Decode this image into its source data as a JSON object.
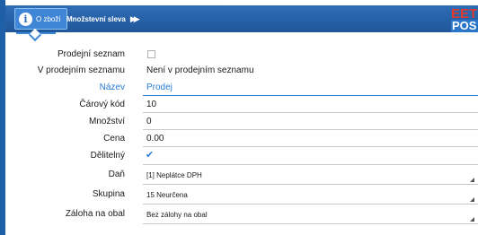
{
  "header": {
    "tab_info_label": "O zboží",
    "tab_discount_label": "Množstevní sleva",
    "logo_top": "EET",
    "logo_bottom": "POS"
  },
  "fields": {
    "sale_list_label": "Prodejní seznam",
    "in_sale_list_label": "V prodejním seznamu",
    "in_sale_list_value": "Není v prodejním seznamu",
    "name_label": "Název",
    "name_value": "Prodej",
    "barcode_label": "Čárový kód",
    "barcode_value": "10",
    "quantity_label": "Množství",
    "quantity_value": "0",
    "price_label": "Cena",
    "price_value": "0.00",
    "divisible_label": "Dělitelný",
    "tax_label": "Daň",
    "tax_value": "[1] Neplátce DPH",
    "group_label": "Skupina",
    "group_value": "15 Neurčena",
    "deposit_label": "Záloha na obal",
    "deposit_value": "Bez zálohy na obal"
  },
  "state": {
    "sale_list_checked": false,
    "divisible_checked": true
  },
  "colors": {
    "header_blue": "#1f579b",
    "accent_blue": "#2a7bd4",
    "logo_red": "#e03a2e"
  },
  "icons": [
    "info-icon",
    "fast-forward-icon",
    "checkbox-icon",
    "check-icon",
    "dropdown-arrow-icon"
  ]
}
